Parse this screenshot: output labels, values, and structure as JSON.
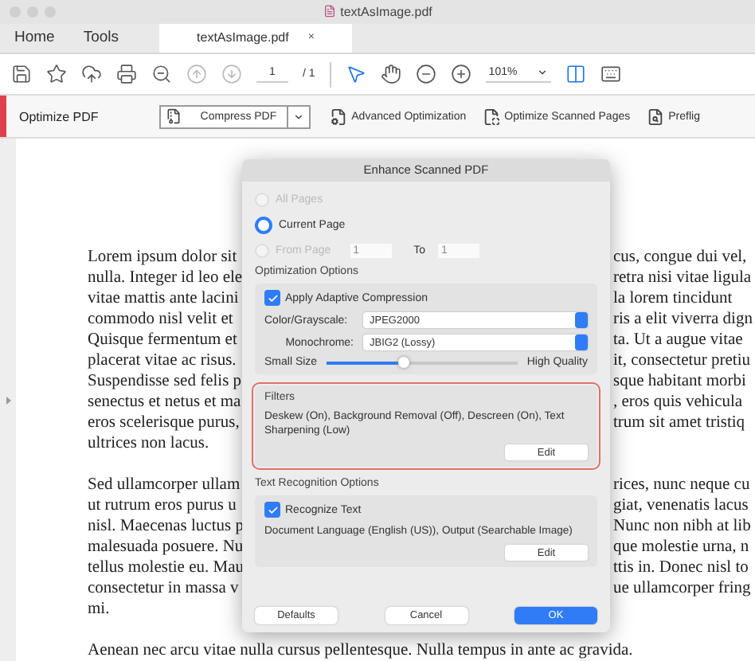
{
  "window": {
    "title": "textAsImage.pdf"
  },
  "tabs": [
    {
      "label": "Home",
      "selected": false
    },
    {
      "label": "Tools",
      "selected": false
    },
    {
      "label": "textAsImage.pdf",
      "selected": true,
      "close": "×"
    }
  ],
  "toolbar": {
    "page_current": "1",
    "page_total": "/ 1",
    "zoom": "101%"
  },
  "optimize_bar": {
    "title": "Optimize PDF",
    "tools": [
      {
        "label": "Compress PDF",
        "kind": "split"
      },
      {
        "label": "Advanced Optimization",
        "kind": "tool"
      },
      {
        "label": "Optimize Scanned Pages",
        "kind": "tool"
      },
      {
        "label": "Preflig",
        "kind": "tool"
      }
    ]
  },
  "document": {
    "paragraphs": [
      {
        "lines": [
          {
            "left": "Lorem ipsum dolor sit",
            "right": "cus, congue dui vel,"
          },
          {
            "left": "nulla. Integer id leo ele",
            "right": "retra nisi vitae ligula"
          },
          {
            "left": "vitae mattis ante lacini",
            "right": "la lorem tincidunt"
          },
          {
            "left": "commodo nisl velit et",
            "right": "ris a elit viverra dign"
          },
          {
            "left": "Quisque fermentum et",
            "right": "ta. Ut a augue vitae"
          },
          {
            "left": "placerat vitae ac risus.",
            "right": "it, consectetur pretiu"
          },
          {
            "left": "Suspendisse sed felis p",
            "right": "sque habitant morbi"
          },
          {
            "left": "senectus et netus et ma",
            "right": ", eros quis vehicula"
          },
          {
            "left": "eros scelerisque purus,",
            "right": "trum sit amet tristiq"
          },
          {
            "left": "ultrices non lacus."
          }
        ]
      },
      {
        "lines": [
          {
            "left": "Sed ullamcorper ullam",
            "right": "rices, nunc neque cu"
          },
          {
            "left": "ut rutrum eros purus u",
            "right": "giat, venenatis lacus"
          },
          {
            "left": "nisl. Maecenas luctus p",
            "right": "Nunc non nibh at lib"
          },
          {
            "left": "malesuada posuere. Nu",
            "right": "que molestie urna, n"
          },
          {
            "left": "tellus molestie eu. Mau",
            "right": "ttis in. Donec nisl to"
          },
          {
            "left": "consectetur in massa v",
            "right": "ue ullamcorper fring"
          },
          {
            "left": "mi."
          }
        ]
      }
    ],
    "last_line": "Aenean nec arcu vitae nulla cursus pellentesque. Nulla tempus in ante ac gravida."
  },
  "dialog": {
    "title": "Enhance Scanned PDF",
    "pages": [
      {
        "label": "All Pages",
        "selected": false,
        "disabled": true
      },
      {
        "label": "Current Page",
        "selected": true,
        "disabled": false
      },
      {
        "label": "From Page",
        "selected": false,
        "disabled": true,
        "from": "1",
        "to_label": "To",
        "to": "1"
      }
    ],
    "optimization": {
      "title": "Optimization Options",
      "adaptive": {
        "label": "Apply Adaptive Compression",
        "checked": true
      },
      "selects": [
        {
          "label": "Color/Grayscale:",
          "value": "JPEG2000"
        },
        {
          "label": "Monochrome:",
          "value": "JBIG2 (Lossy)"
        }
      ],
      "slider": {
        "min_label": "Small Size",
        "max_label": "High Quality",
        "level": 0.4
      }
    },
    "filters": {
      "title": "Filters",
      "text": "Deskew (On), Background Removal (Off), Descreen (On), Text Sharpening (Low)",
      "button": "Edit",
      "highlighted": true
    },
    "recognition": {
      "title": "Text Recognition Options",
      "recognize": {
        "label": "Recognize Text",
        "checked": true
      },
      "text": "Document Language (English (US)), Output (Searchable Image)",
      "button": "Edit"
    },
    "buttons": [
      {
        "label": "Defaults",
        "primary": false
      },
      {
        "label": "Cancel",
        "primary": false
      },
      {
        "label": "OK",
        "primary": true
      }
    ]
  }
}
